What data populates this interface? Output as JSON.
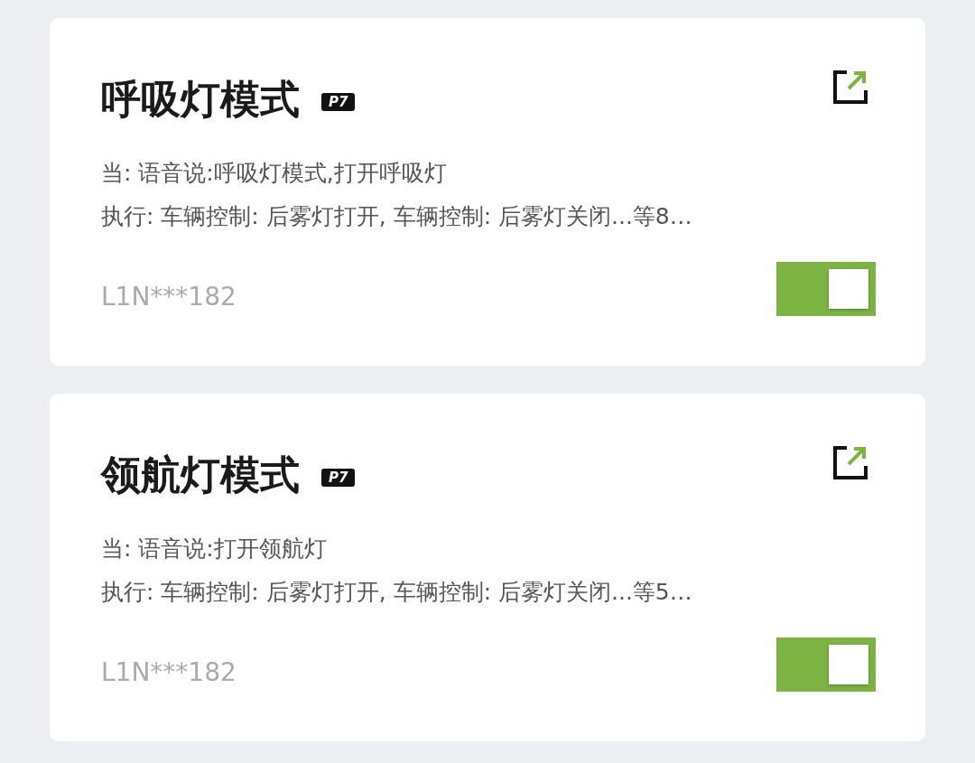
{
  "cards": [
    {
      "title": "呼吸灯模式",
      "badge": "P7",
      "trigger": "当: 语音说:呼吸灯模式,打开呼吸灯",
      "action": "执行: 车辆控制: 后雾灯打开, 车辆控制: 后雾灯关闭...等8…",
      "plate": "L1N***182",
      "on": true
    },
    {
      "title": "领航灯模式",
      "badge": "P7",
      "trigger": "当: 语音说:打开领航灯",
      "action": "执行: 车辆控制: 后雾灯打开, 车辆控制: 后雾灯关闭...等5…",
      "plate": "L1N***182",
      "on": true
    }
  ]
}
